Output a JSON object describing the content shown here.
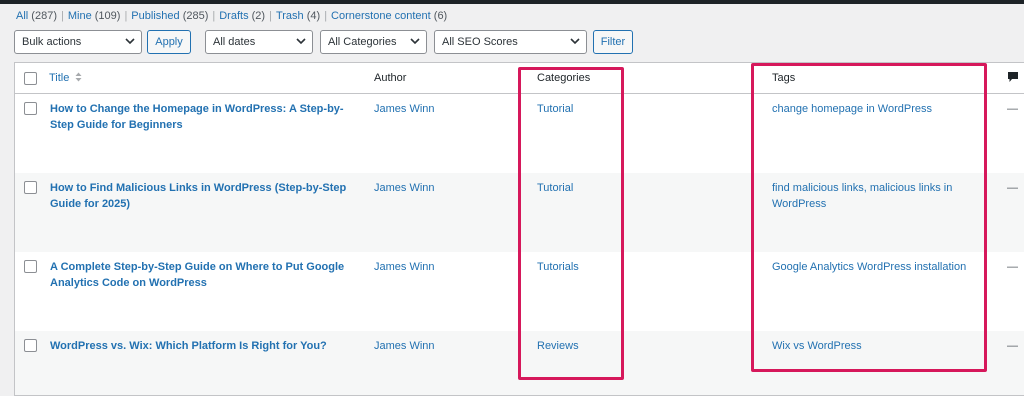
{
  "views": [
    {
      "label": "All",
      "count": "(287)"
    },
    {
      "label": "Mine",
      "count": "(109)"
    },
    {
      "label": "Published",
      "count": "(285)"
    },
    {
      "label": "Drafts",
      "count": "(2)"
    },
    {
      "label": "Trash",
      "count": "(4)"
    },
    {
      "label": "Cornerstone content",
      "count": "(6)"
    }
  ],
  "filters": {
    "bulk_actions": "Bulk actions",
    "apply": "Apply",
    "dates": "All dates",
    "categories": "All Categories",
    "seo": "All SEO Scores",
    "filter": "Filter"
  },
  "columns": {
    "title": "Title",
    "author": "Author",
    "categories": "Categories",
    "tags": "Tags"
  },
  "rows": [
    {
      "title": "How to Change the Homepage in WordPress: A Step-by-Step Guide for Beginners",
      "author": "James Winn",
      "category": "Tutorial",
      "tags": "change homepage in WordPress",
      "comments": "—"
    },
    {
      "title": "How to Find Malicious Links in WordPress (Step-by-Step Guide for 2025)",
      "author": "James Winn",
      "category": "Tutorial",
      "tags": "find malicious links, malicious links in WordPress",
      "comments": "—"
    },
    {
      "title": "A Complete Step-by-Step Guide on Where to Put Google Analytics Code on WordPress",
      "author": "James Winn",
      "category": "Tutorials",
      "tags": "Google Analytics WordPress installation",
      "comments": "—"
    },
    {
      "title": "WordPress vs. Wix: Which Platform Is Right for You?",
      "author": "James Winn",
      "category": "Reviews",
      "tags": "Wix vs WordPress",
      "comments": "—"
    }
  ],
  "highlight_color": "#d6185b"
}
